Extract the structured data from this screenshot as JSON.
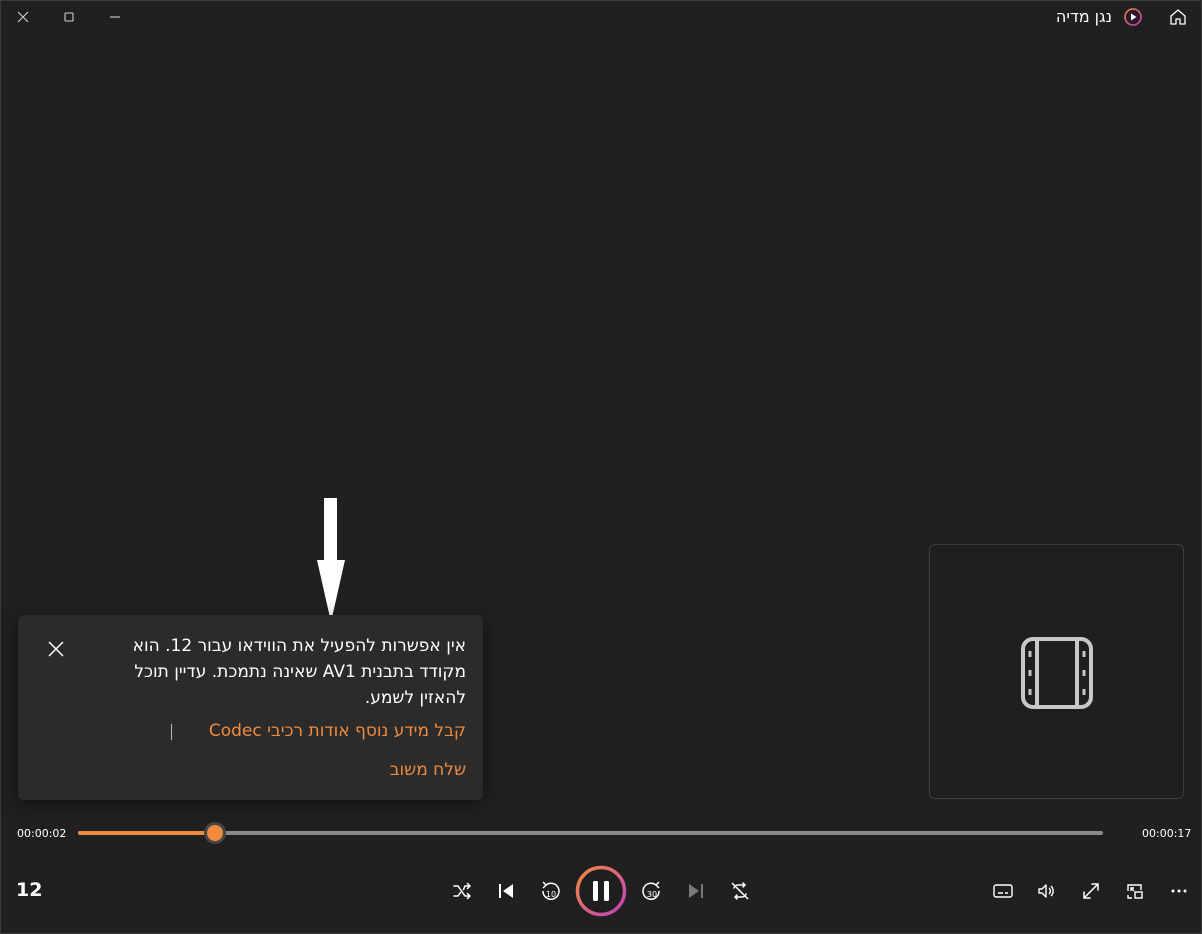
{
  "app": {
    "title": "נגן מדיה",
    "icons": {
      "logo": "media-player-logo-icon",
      "home": "home-icon",
      "close": "close-icon",
      "maximize": "maximize-icon",
      "minimize": "minimize-icon"
    }
  },
  "notification": {
    "message": "אין אפשרות להפעיל את הווידאו עבור 12. הוא מקודד בתבנית AV1 שאינה נתמכת. עדיין תוכל להאזין לשמע.",
    "learn_more_link": "קבל מידע נוסף אודות רכיבי Codec",
    "feedback_link": "שלח משוב",
    "close_icon": "close-icon"
  },
  "thumbnail": {
    "icon": "film-strip-icon"
  },
  "player": {
    "elapsed": "00:00:02",
    "duration": "00:00:17",
    "progress_fraction": 0.134,
    "track_title": "12"
  },
  "controls": {
    "shuffle": "shuffle-icon",
    "previous": "previous-icon",
    "skip_back": "skip-back-10-icon",
    "skip_back_label": "10",
    "pause": "pause-icon",
    "skip_forward": "skip-forward-30-icon",
    "skip_forward_label": "30",
    "next": "next-icon",
    "repeat": "repeat-off-icon",
    "captions": "captions-icon",
    "volume": "volume-icon",
    "fullscreen": "fullscreen-icon",
    "mini_player": "mini-player-icon",
    "more": "more-icon"
  },
  "colors": {
    "accent": "#f08a3c",
    "accent_secondary": "#c13fbf",
    "background": "#202020",
    "panel": "#2b2b2b"
  }
}
